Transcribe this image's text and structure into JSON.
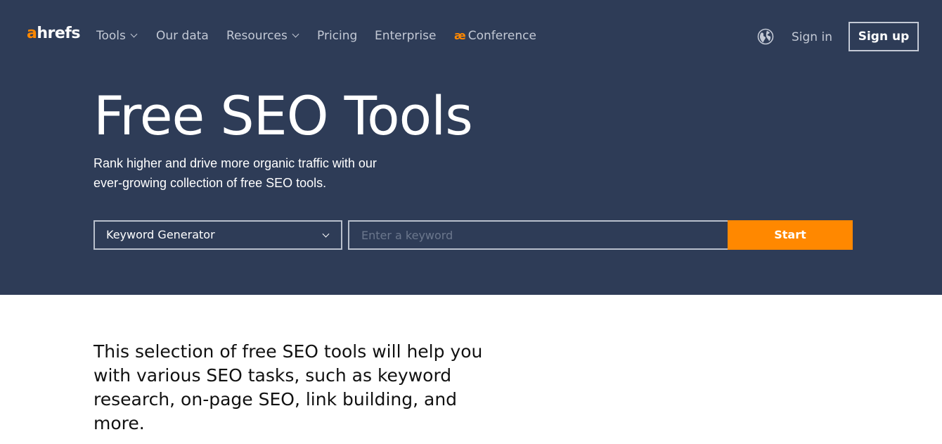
{
  "nav": {
    "logo_accent": "a",
    "logo_rest": "hrefs",
    "items": [
      {
        "label": "Tools",
        "has_dropdown": true
      },
      {
        "label": "Our data",
        "has_dropdown": false
      },
      {
        "label": "Resources",
        "has_dropdown": true
      },
      {
        "label": "Pricing",
        "has_dropdown": false
      },
      {
        "label": "Enterprise",
        "has_dropdown": false
      },
      {
        "label": "Conference",
        "has_dropdown": false,
        "icon": "ahrefs-evolve-logo"
      }
    ],
    "conference_icon_text": "æ",
    "language_icon": "globe-icon",
    "signin_label": "Sign in",
    "signup_label": "Sign up"
  },
  "hero": {
    "title": "Free SEO Tools",
    "subtitle_line1": "Rank higher and drive more organic traffic with our",
    "subtitle_line2": "ever-growing collection of free SEO tools.",
    "tool_select_value": "Keyword Generator",
    "keyword_placeholder": "Enter a keyword",
    "start_label": "Start"
  },
  "intro": {
    "text": "This selection of free SEO tools will help you with various SEO tasks, such as keyword research, on-page SEO, link building, and more."
  },
  "colors": {
    "hero_bg": "#2e3c57",
    "accent": "#ff8800",
    "nav_text": "#c3c9d5"
  }
}
